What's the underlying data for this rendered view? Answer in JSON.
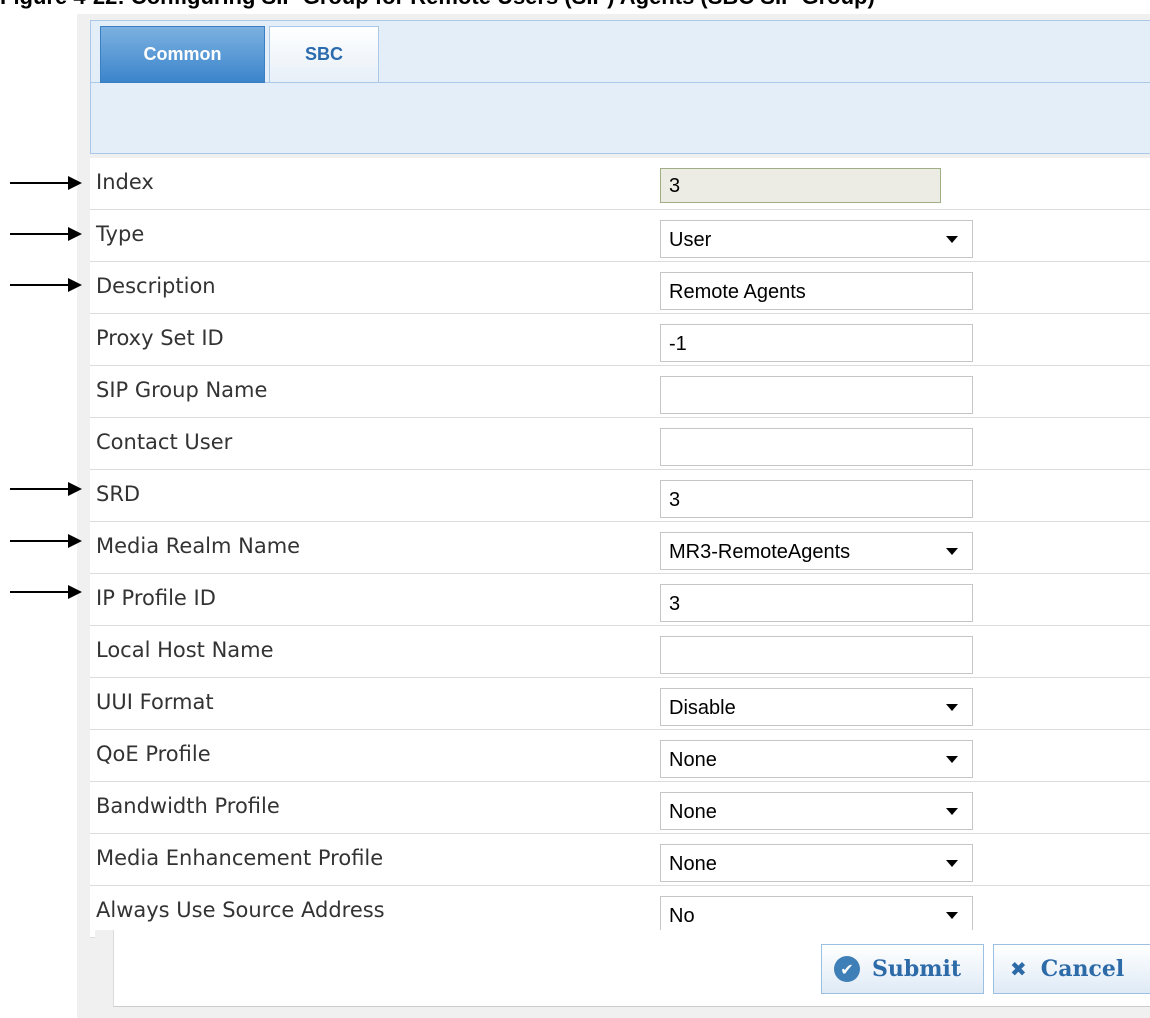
{
  "caption": "Figure 4-22: Configuring SIP Group for Remote Users (SIP) Agents (SBC SIP Group)",
  "tabs": [
    {
      "label": "Common",
      "active": true
    },
    {
      "label": "SBC",
      "active": false
    }
  ],
  "form": {
    "index": {
      "label": "Index",
      "value": "3"
    },
    "type": {
      "label": "Type",
      "value": "User"
    },
    "description": {
      "label": "Description",
      "value": "Remote Agents"
    },
    "proxy_set_id": {
      "label": "Proxy Set ID",
      "value": "-1"
    },
    "sip_group_name": {
      "label": "SIP Group Name",
      "value": ""
    },
    "contact_user": {
      "label": "Contact User",
      "value": ""
    },
    "srd": {
      "label": "SRD",
      "value": "3"
    },
    "media_realm_name": {
      "label": "Media Realm Name",
      "value": "MR3-RemoteAgents"
    },
    "ip_profile_id": {
      "label": "IP Profile ID",
      "value": "3"
    },
    "local_host_name": {
      "label": "Local Host Name",
      "value": ""
    },
    "uui_format": {
      "label": "UUI Format",
      "value": "Disable"
    },
    "qoe_profile": {
      "label": "QoE Profile",
      "value": "None"
    },
    "bandwidth_profile": {
      "label": "Bandwidth Profile",
      "value": "None"
    },
    "media_enhancement_profile": {
      "label": "Media Enhancement Profile",
      "value": "None"
    },
    "always_use_source_address": {
      "label": "Always Use Source Address",
      "value": "No"
    }
  },
  "buttons": {
    "submit": "Submit",
    "cancel": "Cancel"
  },
  "colors": {
    "accent": "#3b85cc",
    "button_text": "#2c6aa8"
  }
}
